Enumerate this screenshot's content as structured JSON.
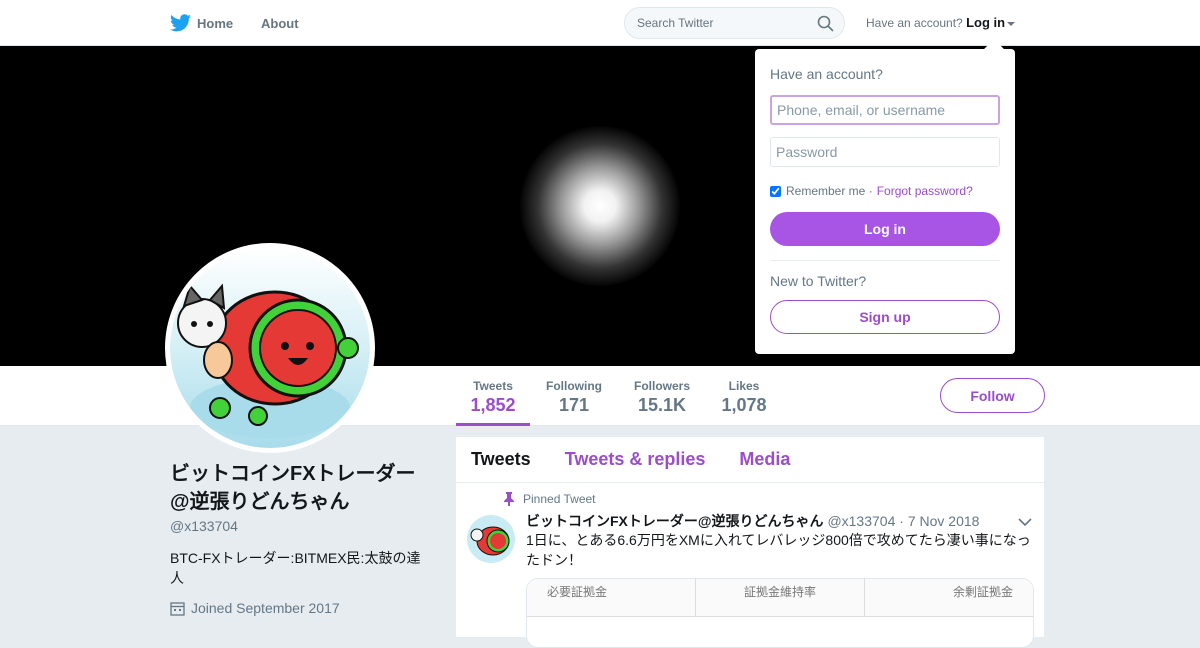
{
  "nav": {
    "home_label": "Home",
    "about_label": "About",
    "search_placeholder": "Search Twitter",
    "have_account": "Have an account?",
    "login_label": "Log in"
  },
  "profile": {
    "name": "ビットコインFXトレーダー@逆張りどんちゃん",
    "handle": "@x133704",
    "bio": "BTC-FXトレーダー:BITMEX民:太鼓の達人",
    "joined": "Joined September 2017",
    "follow_label": "Follow"
  },
  "stats": [
    {
      "label": "Tweets",
      "value": "1,852"
    },
    {
      "label": "Following",
      "value": "171"
    },
    {
      "label": "Followers",
      "value": "15.1K"
    },
    {
      "label": "Likes",
      "value": "1,078"
    }
  ],
  "timeline": {
    "tabs": [
      "Tweets",
      "Tweets & replies",
      "Media"
    ],
    "pinned_label": "Pinned Tweet",
    "tweet": {
      "name": "ビットコインFXトレーダー@逆張りどんちゃん",
      "handle": "@x133704",
      "date": "· 7 Nov 2018",
      "text": "1日に、とある6.6万円をXMに入れてレバレッジ800倍で攻めてたら凄い事になったドン！",
      "media_labels": [
        "必要証拠金",
        "証拠金維持率",
        "余剰証拠金"
      ]
    }
  },
  "login_dropdown": {
    "title": "Have an account?",
    "username_placeholder": "Phone, email, or username",
    "password_placeholder": "Password",
    "remember": "Remember me",
    "forgot": "Forgot password?",
    "login_button": "Log in",
    "new_to": "New to Twitter?",
    "signup_button": "Sign up"
  },
  "colors": {
    "accent": "#9b4dca",
    "login_button": "#a855e6",
    "background": "#e6ecf0"
  }
}
